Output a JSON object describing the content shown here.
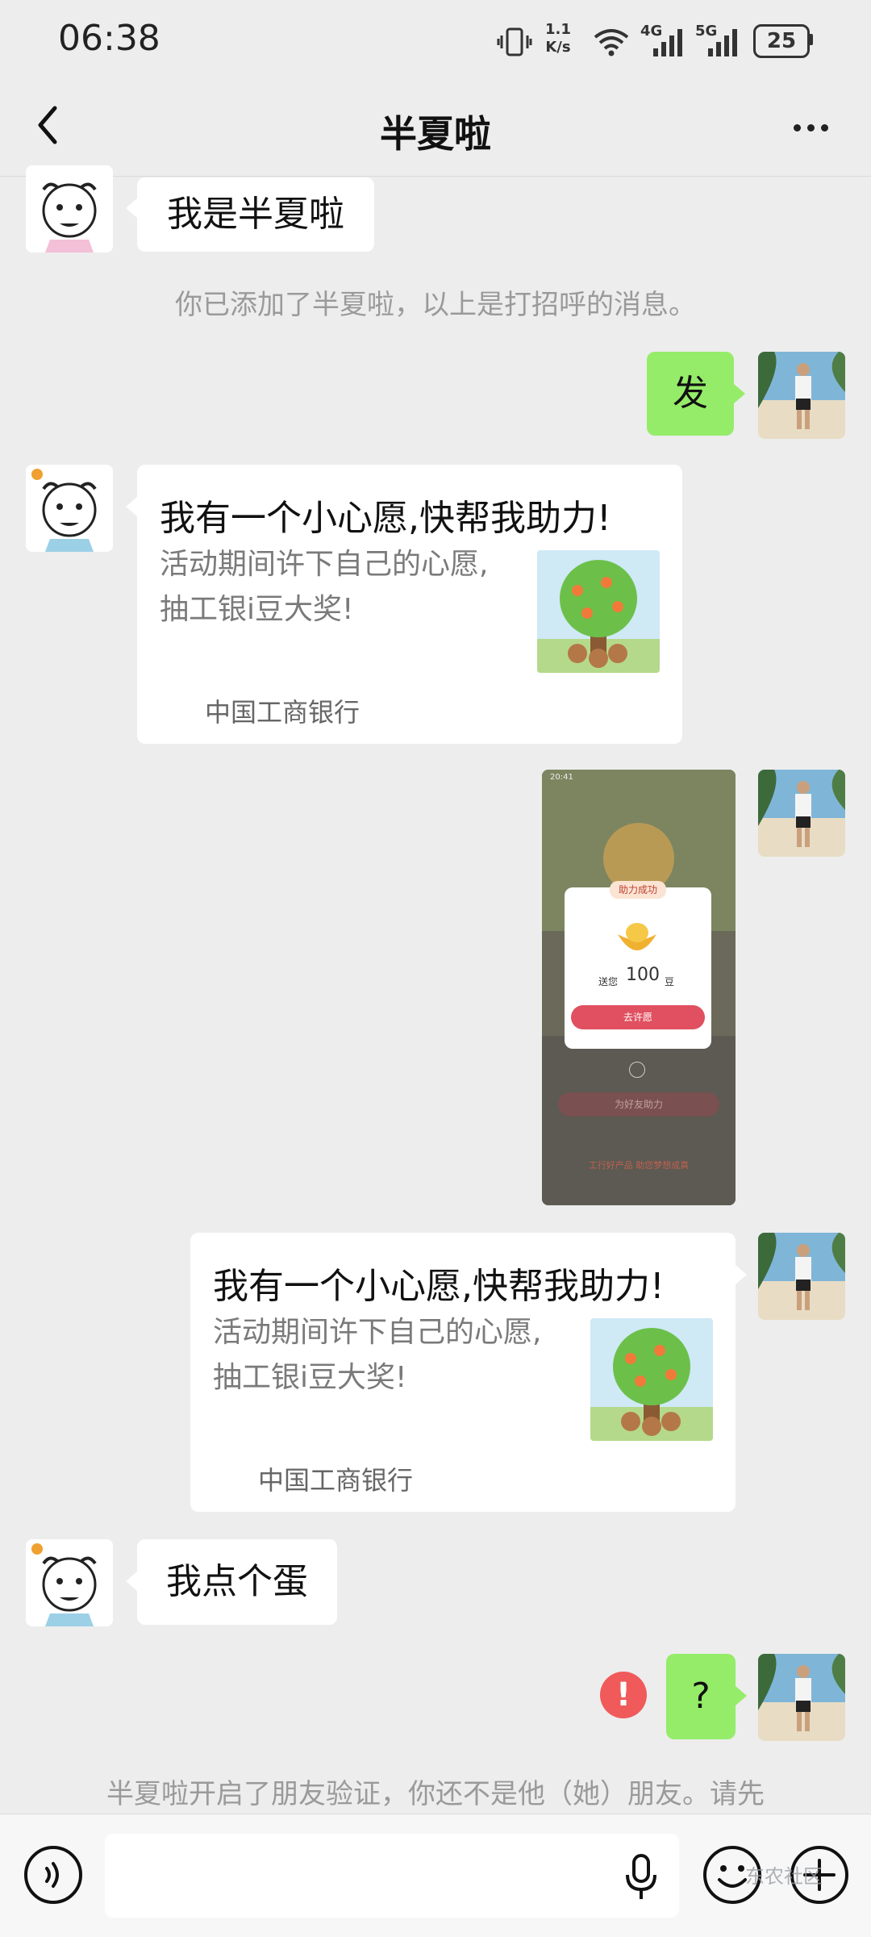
{
  "status_bar": {
    "time": "06:38",
    "net_speed_top": "1.1",
    "net_speed_bottom": "K/s",
    "signal_1": "4G",
    "signal_2": "5G",
    "battery": "25"
  },
  "header": {
    "title": "半夏啦",
    "back_icon": "chevron-left-icon",
    "more_icon": "more-horizontal-icon"
  },
  "messages": {
    "m1_text": "我是半夏啦",
    "system_added": "你已添加了半夏啦，以上是打招呼的消息。",
    "m2_text": "发",
    "card1": {
      "title": "我有一个小心愿,快帮我助力!",
      "desc_line1": "活动期间许下自己的心愿,",
      "desc_line2": "抽工银i豆大奖!",
      "source": "中国工商银行"
    },
    "screenshot": {
      "status_time": "20:41",
      "popup_title": "助力成功",
      "gift_prefix": "送您",
      "gift_amount": "100",
      "gift_unit": "豆",
      "popup_button": "去许愿",
      "bottom_button": "为好友助力",
      "footer": "工行好产品 助您梦想成真"
    },
    "card2": {
      "title": "我有一个小心愿,快帮我助力!",
      "desc_line1": "活动期间许下自己的心愿,",
      "desc_line2": "抽工银i豆大奖!",
      "source": "中国工商银行"
    },
    "m5_text": "我点个蛋",
    "m6_text": "?",
    "m6_error": "!",
    "system_verify": "半夏啦开启了朋友验证，你还不是他（她）朋友。请先"
  },
  "input_bar": {
    "voice_icon": "voice-icon",
    "mic_icon": "microphone-icon",
    "emoji_icon": "emoji-icon",
    "plus_icon": "plus-circle-icon",
    "watermark": "东农社区"
  },
  "colors": {
    "background": "#ededed",
    "green_bubble": "#95ec69",
    "error_red": "#f05a5a"
  }
}
